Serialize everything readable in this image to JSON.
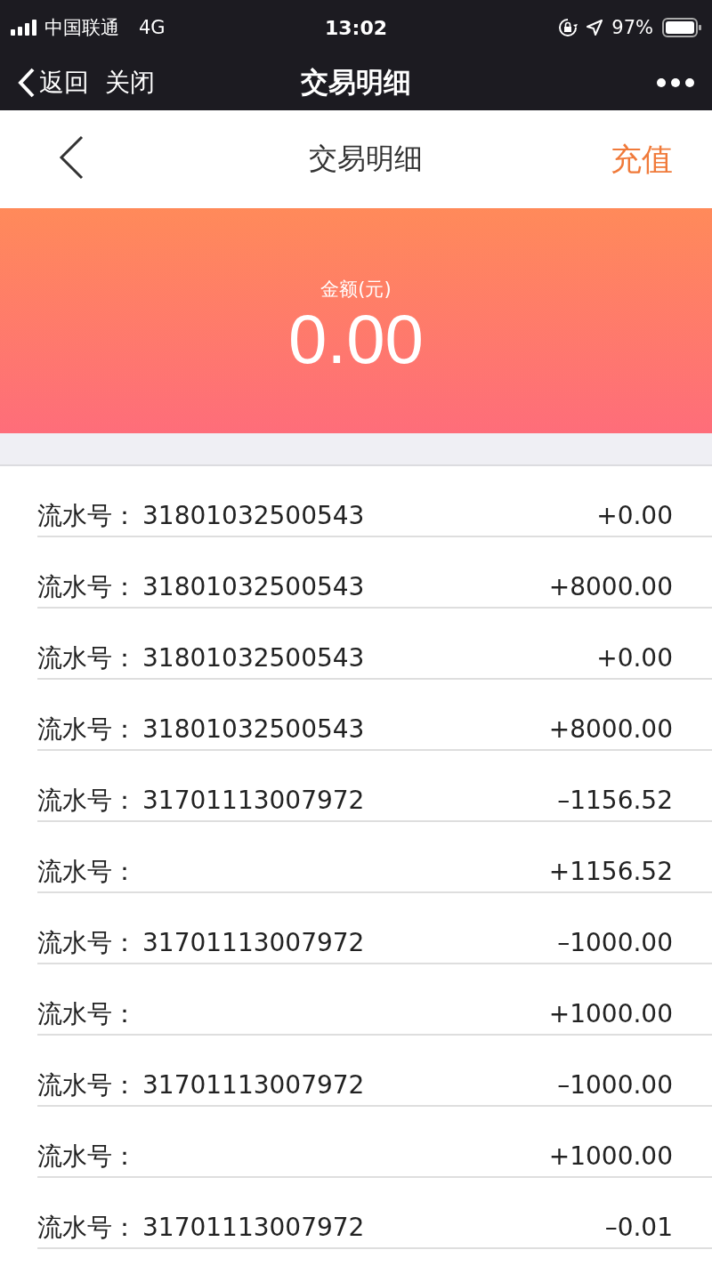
{
  "status_bar": {
    "carrier": "中国联通",
    "network": "4G",
    "time": "13:02",
    "battery": "97%"
  },
  "wechat_bar": {
    "back": "返回",
    "close": "关闭",
    "title": "交易明细"
  },
  "header": {
    "title": "交易明细",
    "action": "充值"
  },
  "balance": {
    "label": "金额(元)",
    "amount": "0.00"
  },
  "transactions": [
    {
      "label": "流水号：",
      "serial": "31801032500543",
      "amount": "+0.00"
    },
    {
      "label": "流水号：",
      "serial": "31801032500543",
      "amount": "+8000.00"
    },
    {
      "label": "流水号：",
      "serial": "31801032500543",
      "amount": "+0.00"
    },
    {
      "label": "流水号：",
      "serial": "31801032500543",
      "amount": "+8000.00"
    },
    {
      "label": "流水号：",
      "serial": "31701113007972",
      "amount": "–1156.52"
    },
    {
      "label": "流水号：",
      "amount": "+1156.52"
    },
    {
      "label": "流水号：",
      "serial": "31701113007972",
      "amount": "–1000.00"
    },
    {
      "label": "流水号：",
      "amount": "+1000.00"
    },
    {
      "label": "流水号：",
      "serial": "31701113007972",
      "amount": "–1000.00"
    },
    {
      "label": "流水号：",
      "amount": "+1000.00"
    },
    {
      "label": "流水号：",
      "serial": "31701113007972",
      "amount": "–0.01"
    }
  ]
}
